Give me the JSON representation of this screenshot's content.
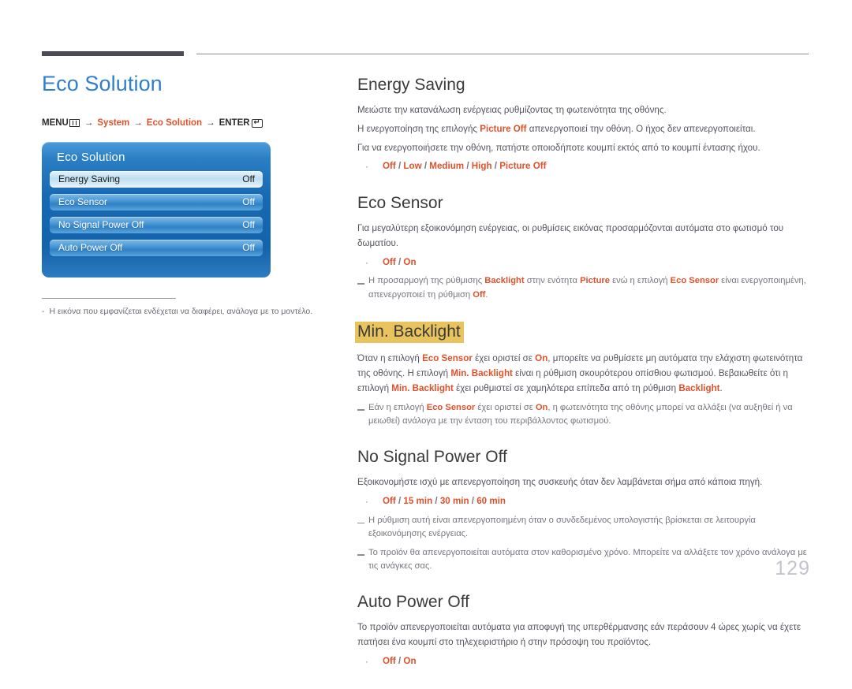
{
  "page": {
    "title": "Eco Solution",
    "number": "129",
    "accent_blue": "#2f7fd0",
    "accent_orange": "#e0512a",
    "highlight_gold": "#e9c35e"
  },
  "menu_path": {
    "menu_label": "MENU",
    "menu_icon": "menu-grid-icon",
    "arrow": "→",
    "step1": "System",
    "step2": "Eco Solution",
    "enter_label": "ENTER",
    "enter_icon": "enter-return-icon",
    "enter_glyph": "↵"
  },
  "osd": {
    "title": "Eco Solution",
    "rows": [
      {
        "label": "Energy Saving",
        "value": "Off",
        "selected": true
      },
      {
        "label": "Eco Sensor",
        "value": "Off",
        "selected": false
      },
      {
        "label": "No Signal Power Off",
        "value": "Off",
        "selected": false
      },
      {
        "label": "Auto Power Off",
        "value": "Off",
        "selected": false
      }
    ]
  },
  "left_note": {
    "dash": "-",
    "text": "Η εικόνα που εμφανίζεται ενδέχεται να διαφέρει, ανάλογα με το μοντέλο."
  },
  "sections": {
    "energy_saving": {
      "title": "Energy Saving",
      "p1": "Μειώστε την κατανάλωση ενέργειας ρυθμίζοντας τη φωτεινότητα της οθόνης.",
      "p2_a": "Η ενεργοποίηση της επιλογής ",
      "p2_kw": "Picture Off",
      "p2_b": " απενεργοποιεί την οθόνη. Ο ήχος δεν απενεργοποιείται.",
      "p3": "Για να ενεργοποιήσετε την οθόνη, πατήστε οποιοδήποτε κουμπί εκτός από το κουμπί έντασης ήχου.",
      "options": [
        "Off",
        "Low",
        "Medium",
        "High",
        "Picture Off"
      ]
    },
    "eco_sensor": {
      "title": "Eco Sensor",
      "p1": "Για μεγαλύτερη εξοικονόμηση ενέργειας, οι ρυθμίσεις εικόνας προσαρμόζονται αυτόματα στο φωτισμό του δωματίου.",
      "options": [
        "Off",
        "On"
      ],
      "note1_a": "Η προσαρμογή της ρύθμισης ",
      "note1_kw1": "Backlight",
      "note1_b": " στην ενότητα ",
      "note1_kw2": "Picture",
      "note1_c": " ενώ η επιλογή ",
      "note1_kw3": "Eco Sensor",
      "note1_d": " είναι ενεργοποιημένη, απενεργοποιεί τη ρύθμιση ",
      "note1_kw4": "Off",
      "note1_e": "."
    },
    "min_backlight": {
      "title": "Min. Backlight",
      "p1_a": "Όταν η επιλογή ",
      "p1_kw1": "Eco Sensor",
      "p1_b": " έχει οριστεί σε ",
      "p1_kw2": "On",
      "p1_c": ", μπορείτε να ρυθμίσετε μη αυτόματα την ελάχιστη φωτεινότητα της οθόνης. Η επιλογή ",
      "p1_kw3": "Min. Backlight",
      "p1_d": " είναι η ρύθμιση σκουρότερου οπίσθιου φωτισμού. Βεβαιωθείτε ότι η επιλογή ",
      "p1_kw4": "Min. Backlight",
      "p1_e": " έχει ρυθμιστεί σε χαμηλότερα επίπεδα από τη ρύθμιση ",
      "p1_kw5": "Backlight",
      "p1_f": ".",
      "note1_a": "Εάν η επιλογή ",
      "note1_kw1": "Eco Sensor",
      "note1_b": " έχει οριστεί σε ",
      "note1_kw2": "On",
      "note1_c": ", η φωτεινότητα της οθόνης μπορεί να αλλάξει (να αυξηθεί ή να μειωθεί) ανάλογα με την ένταση του περιβάλλοντος φωτισμού."
    },
    "no_signal_power_off": {
      "title": "No Signal Power Off",
      "p1": "Εξοικονομήστε ισχύ με απενεργοποίηση της συσκευής όταν δεν λαμβάνεται σήμα από κάποια πηγή.",
      "options": [
        "Off",
        "15 min",
        "30 min",
        "60 min"
      ],
      "note1": "Η ρύθμιση αυτή είναι απενεργοποιημένη όταν ο συνδεδεμένος υπολογιστής βρίσκεται σε λειτουργία εξοικονόμησης ενέργειας.",
      "note2": "Το προϊόν θα απενεργοποιείται αυτόματα στον καθορισμένο χρόνο. Μπορείτε να αλλάξετε τον χρόνο ανάλογα με τις ανάγκες σας."
    },
    "auto_power_off": {
      "title": "Auto Power Off",
      "p1": "Το προϊόν απενεργοποιείται αυτόματα για αποφυγή της υπερθέρμανσης εάν περάσουν 4 ώρες χωρίς να έχετε πατήσει ένα κουμπί στο τηλεχειριστήριο ή στην πρόσοψη του προϊόντος.",
      "options": [
        "Off",
        "On"
      ]
    }
  }
}
